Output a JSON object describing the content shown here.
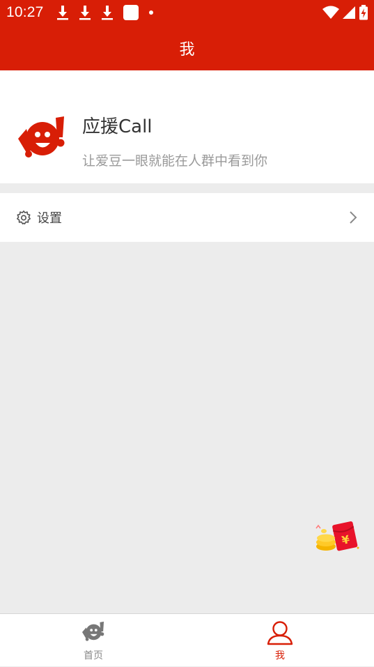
{
  "status_bar": {
    "time": "10:27",
    "left_icons": [
      "download-icon",
      "download-icon",
      "download-icon",
      "app-square-icon",
      "dot-icon"
    ],
    "right_icons": [
      "wifi-icon",
      "signal-icon",
      "battery-charging-icon"
    ]
  },
  "header": {
    "title": "我"
  },
  "profile": {
    "logo": "app-logo-icon",
    "name": "应援Call",
    "subtitle": "让爱豆一眼就能在人群中看到你"
  },
  "settings": {
    "label": "设置",
    "icon": "gear-icon"
  },
  "floating": {
    "icon": "red-packet-icon"
  },
  "tabbar": {
    "tabs": [
      {
        "label": "首页",
        "icon": "home-logo-icon",
        "active": false
      },
      {
        "label": "我",
        "icon": "user-icon",
        "active": true
      }
    ]
  },
  "colors": {
    "primary": "#d81e06",
    "background": "#ececec",
    "text": "#333333",
    "muted": "#9a9a9a"
  }
}
